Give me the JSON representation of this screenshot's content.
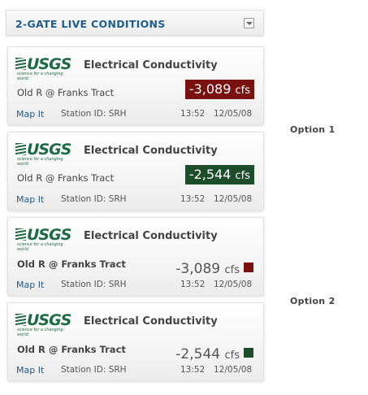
{
  "header": {
    "title": "2-GATE LIVE CONDITIONS"
  },
  "options": [
    "Option 1",
    "Option 2"
  ],
  "cards": [
    {
      "logo": "USGS",
      "logo_tagline": "science for a changing world",
      "measure": "Electrical Conductivity",
      "site": "Old R @ Franks Tract",
      "value": "-3,089",
      "unit": "cfs",
      "color": "#7a1111",
      "map_link": "Map It",
      "station": "Station ID: SRH",
      "time": "13:52",
      "date": "12/05/08"
    },
    {
      "logo": "USGS",
      "logo_tagline": "science for a changing world",
      "measure": "Electrical Conductivity",
      "site": "Old R @ Franks Tract",
      "value": "-2,544",
      "unit": "cfs",
      "color": "#1e4d2b",
      "map_link": "Map It",
      "station": "Station ID: SRH",
      "time": "13:52",
      "date": "12/05/08"
    },
    {
      "logo": "USGS",
      "logo_tagline": "science for a changing world",
      "measure": "Electrical Conductivity",
      "site": "Old R @ Franks Tract",
      "value": "-3,089",
      "unit": "cfs",
      "color": "#7a1111",
      "map_link": "Map It",
      "station": "Station ID: SRH",
      "time": "13:52",
      "date": "12/05/08"
    },
    {
      "logo": "USGS",
      "logo_tagline": "science for a changing world",
      "measure": "Electrical Conductivity",
      "site": "Old R @ Franks Tract",
      "value": "-2,544",
      "unit": "cfs",
      "color": "#1e4d2b",
      "map_link": "Map It",
      "station": "Station ID: SRH",
      "time": "13:52",
      "date": "12/05/08"
    }
  ]
}
